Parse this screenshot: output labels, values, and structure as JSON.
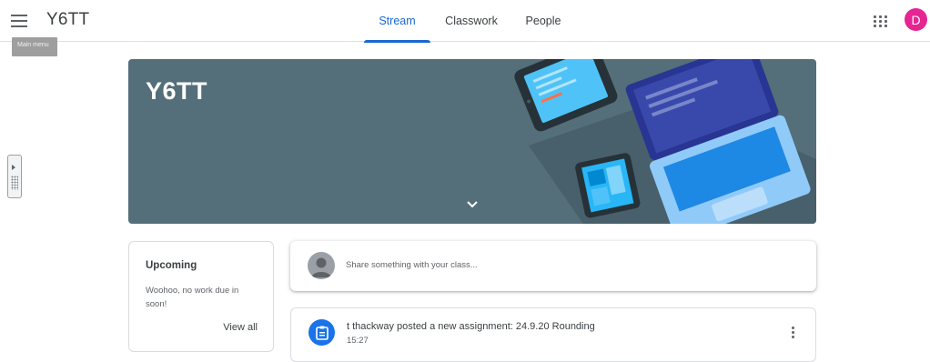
{
  "header": {
    "menu_tooltip": "Main menu",
    "class_name": "Y6TT",
    "avatar_letter": "D",
    "tabs": [
      {
        "label": "Stream",
        "active": true
      },
      {
        "label": "Classwork",
        "active": false
      },
      {
        "label": "People",
        "active": false
      }
    ],
    "accent_color": "#1967d2",
    "avatar_color": "#e52592"
  },
  "banner": {
    "title": "Y6TT",
    "background_color": "#546e7a"
  },
  "upcoming": {
    "title": "Upcoming",
    "message": "Woohoo, no work due in soon!",
    "view_all": "View all"
  },
  "share": {
    "placeholder": "Share something with your class..."
  },
  "posts": [
    {
      "title": "t thackway posted a new assignment: 24.9.20 Rounding",
      "time": "15:27",
      "icon": "assignment-icon"
    }
  ]
}
